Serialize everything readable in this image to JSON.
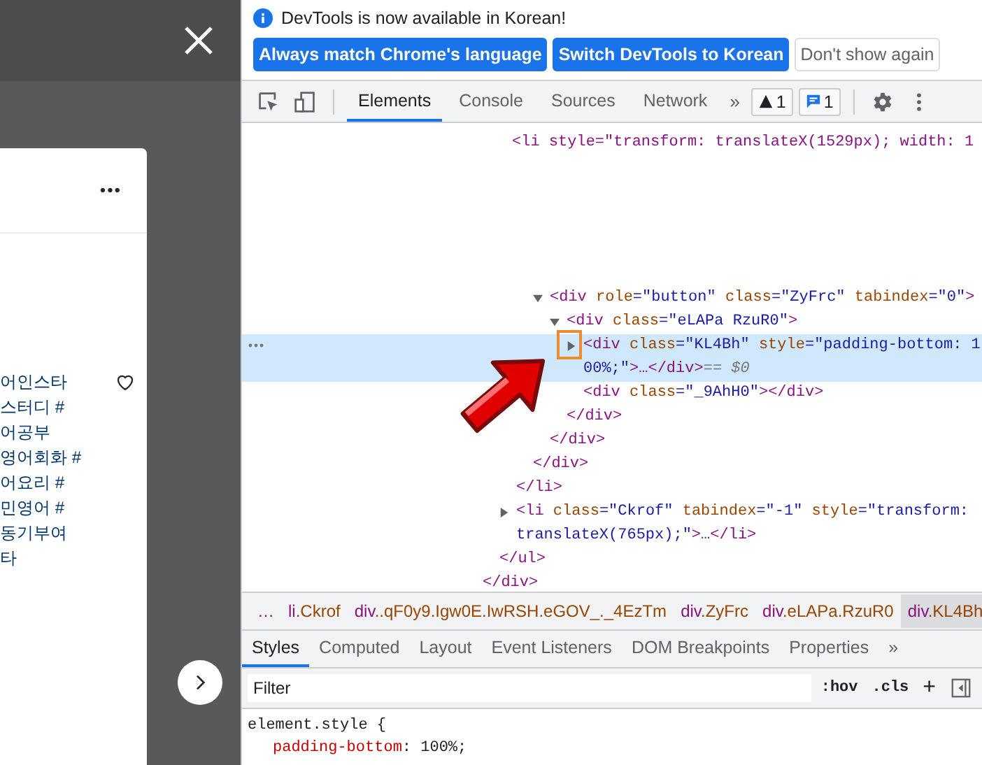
{
  "page": {
    "post_menu": "•••",
    "caption_lines": [
      "어인스타",
      "스터디 #",
      "어공부",
      "영어회화 #",
      "어요리 #",
      "민영어 #",
      "동기부여",
      "타"
    ],
    "liked": false
  },
  "infobar": {
    "message": "DevTools is now available in Korean!",
    "buttons": [
      {
        "label": "Always match Chrome's language",
        "kind": "primary"
      },
      {
        "label": "Switch DevTools to Korean",
        "kind": "primary"
      },
      {
        "label": "Don't show again",
        "kind": "secondary"
      }
    ]
  },
  "toolbar": {
    "tabs": [
      {
        "label": "Elements",
        "selected": true
      },
      {
        "label": "Console",
        "selected": false
      },
      {
        "label": "Sources",
        "selected": false
      },
      {
        "label": "Network",
        "selected": false
      }
    ],
    "more": "»",
    "warnings": "1",
    "messages": "1"
  },
  "dom_tree": {
    "top_line": "<li style=\"transform: translateX(1529px); width: 1",
    "nodes": [
      {
        "close": "</div>",
        "children": [
          {
            "close": "</ul>",
            "children": [
              {
                "close": "</li>",
                "children": [
                  {
                    "close": "</div>",
                    "children": [
                      {
                        "open": "<div role=\"button\" class=\"ZyFrc\" tabindex=\"0\">",
                        "expanded": true,
                        "close": "</div>",
                        "children": [
                          {
                            "open": "<div class=\"eLAPa RzuR0\">",
                            "expanded": true,
                            "close": "</div>",
                            "children": [
                              {
                                "open": "<div class=\"KL4Bh\" style=\"padding-bottom: 100%;\">…</div>",
                                "expanded": false,
                                "selected": true,
                                "suffix": "== $0"
                              },
                              {
                                "open": "<div class=\"_9AhH0\"></div>",
                                "selected": false
                              }
                            ]
                          }
                        ]
                      }
                    ]
                  }
                ]
              },
              {
                "open": "<li class=\"Ckrof\" tabindex=\"-1\" style=\"transform: translateX(765px);\">…</li>",
                "expanded": false,
                "selected": false
              }
            ]
          }
        ]
      }
    ]
  },
  "breadcrumbs": [
    {
      "label": "…",
      "selected": false
    },
    {
      "label": "li.Ckrof",
      "selected": false
    },
    {
      "label": "div..qF0y9.Igw0E.IwRSH.eGOV_._4EzTm",
      "selected": false
    },
    {
      "label": "div.ZyFrc",
      "selected": false
    },
    {
      "label": "div.eLAPa.RzuR0",
      "selected": false
    },
    {
      "label": "div.KL4Bh",
      "selected": true
    }
  ],
  "styles_tabs": [
    {
      "label": "Styles",
      "selected": true
    },
    {
      "label": "Computed",
      "selected": false
    },
    {
      "label": "Layout",
      "selected": false
    },
    {
      "label": "Event Listeners",
      "selected": false
    },
    {
      "label": "DOM Breakpoints",
      "selected": false
    },
    {
      "label": "Properties",
      "selected": false
    }
  ],
  "styles_more": "»",
  "filter": {
    "placeholder": "Filter",
    "hov": ":hov",
    "cls": ".cls",
    "add": "+"
  },
  "styles": {
    "selector": "element.style {",
    "property": "padding-bottom",
    "colon": ":",
    "value": "100%;"
  }
}
